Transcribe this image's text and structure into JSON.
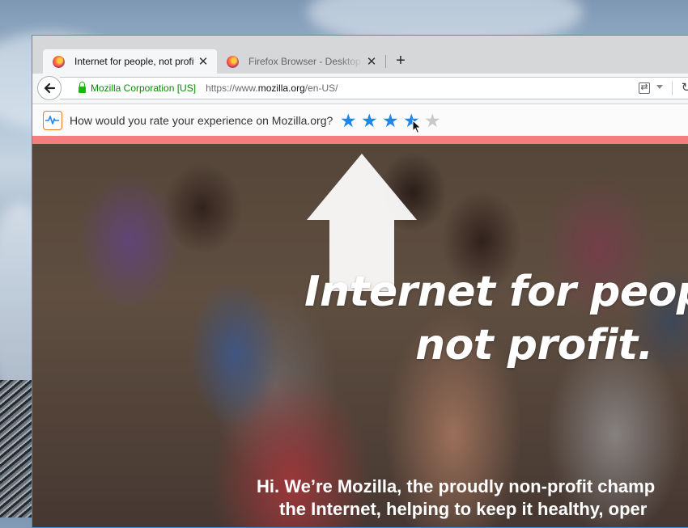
{
  "browser": {
    "tabs": [
      {
        "label": "Internet for people, not profit",
        "active": true,
        "icon": "firefox-icon"
      },
      {
        "label": "Firefox Browser - Desktop…",
        "active": false,
        "icon": "firefox-icon"
      }
    ],
    "close_glyph": "✕",
    "new_tab_glyph": "+",
    "identity": "Mozilla Corporation [US]",
    "url_prefix": "https://www.",
    "url_domain": "mozilla.org",
    "url_path": "/en-US/"
  },
  "notification": {
    "icon": "heartbeat-icon",
    "question": "How would you rate your experience on Mozilla.org?",
    "rating_max": 5,
    "rating_hover": 4,
    "star_glyph": "★"
  },
  "hero": {
    "headline_line1": "Internet for people,",
    "headline_line2": "not profit.",
    "sub_line1": "Hi. We’re Mozilla, the proudly non-profit champ",
    "sub_line2": "the Internet, helping to keep it healthy, oper"
  },
  "colors": {
    "accent_blue": "#1f86e8",
    "secure_green": "#058b00",
    "notification_highlight": "#f47d7d",
    "window_border": "#3a8ee6"
  }
}
